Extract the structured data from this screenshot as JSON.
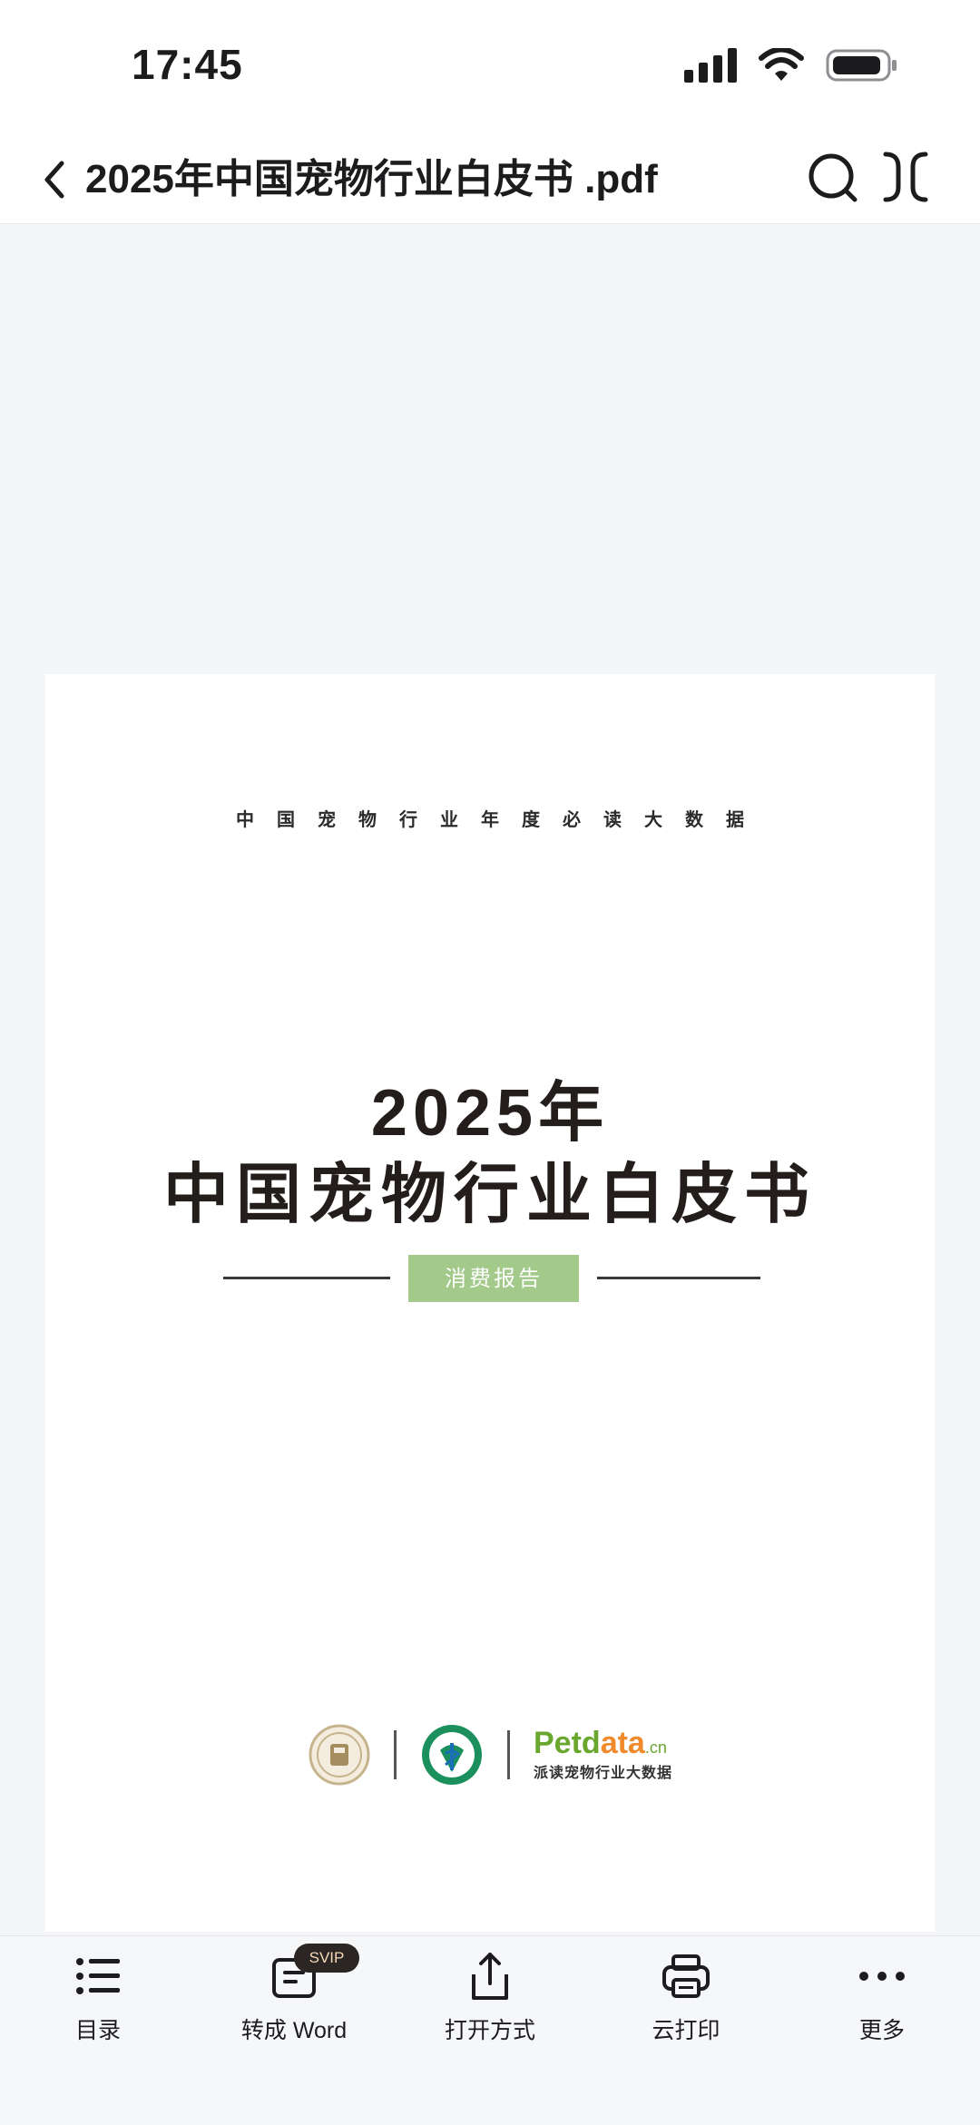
{
  "status_bar": {
    "time": "17:45"
  },
  "nav": {
    "title": "2025年中国宠物行业白皮书 .pdf"
  },
  "document": {
    "tagline": "中国宠物行业年度必读大数据",
    "year": "2025年",
    "title": "中国宠物行业白皮书",
    "badge": "消费报告",
    "logo_petdata_a": "Petd",
    "logo_petdata_b": "ata",
    "logo_petdata_suffix": ".cn",
    "logo_petdata_sub": "派读宠物行业大数据"
  },
  "toolbar": {
    "toc": "目录",
    "to_word": "转成 Word",
    "svip": "SVIP",
    "open_with": "打开方式",
    "cloud_print": "云打印",
    "more": "更多"
  },
  "colors": {
    "badge_green": "#a3c98b",
    "petdata_green": "#6aa72f",
    "petdata_orange": "#f08a2a"
  },
  "icons": [
    "signal-icon",
    "wifi-icon",
    "battery-icon",
    "back-icon",
    "search-icon",
    "fullscreen-icon",
    "list-icon",
    "convert-doc-icon",
    "share-icon",
    "print-icon",
    "more-icon"
  ]
}
